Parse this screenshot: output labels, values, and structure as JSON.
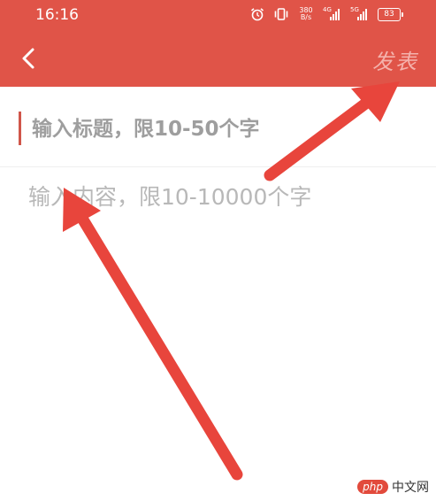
{
  "status_bar": {
    "time": "16:16",
    "net_speed_value": "380",
    "net_speed_unit": "B/s",
    "signal_1_label": "4G",
    "signal_2_label": "5G",
    "battery": "83"
  },
  "header": {
    "back_icon": "chevron-left-icon",
    "publish_label": "发表"
  },
  "form": {
    "title_placeholder": "输入标题，限10-50个字",
    "content_placeholder": "输入内容，限10-10000个字"
  },
  "watermark": {
    "logo": "php",
    "text": "中文网"
  },
  "colors": {
    "header_bg": "#e05448",
    "arrow": "#e8453c",
    "publish_text": "#f4b2ac"
  }
}
